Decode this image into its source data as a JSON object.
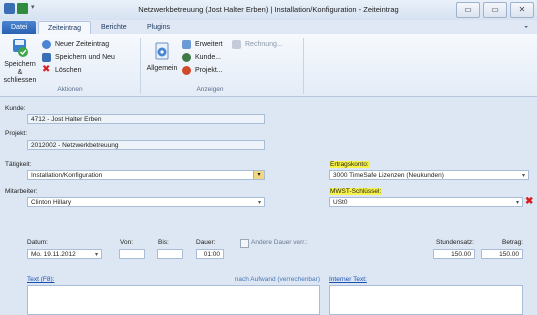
{
  "window": {
    "title": "Netzwerkbetreuung (Jost Halter Erben) | Installation/Konfiguration - Zeiteintrag",
    "controls": {
      "minimize": "▭",
      "maximize": "▭",
      "close": "✕"
    }
  },
  "tabs": [
    {
      "label": "Datei"
    },
    {
      "label": "Zeiteintrag"
    },
    {
      "label": "Berichte"
    },
    {
      "label": "Plugins"
    }
  ],
  "ribbon": {
    "aktionen": {
      "label": "Aktionen",
      "save_close": "Speichern & schliessen",
      "new_entry": "Neuer Zeiteintrag",
      "save_new": "Speichern und Neu",
      "delete": "Löschen"
    },
    "anzeigen": {
      "label": "Anzeigen",
      "allgemein": "Allgemein",
      "erweitert": "Erweitert",
      "rechnung": "Rechnung...",
      "kunde": "Kunde...",
      "projekt": "Projekt..."
    }
  },
  "form": {
    "kunde": {
      "label": "Kunde:",
      "value": "4712 - Jost Halter Erben"
    },
    "projekt": {
      "label": "Projekt:",
      "value": "2012002 - Netzwerkbetreuung"
    },
    "taetigkeit": {
      "label": "Tätigkeit:",
      "value": "Installation/Konfiguration"
    },
    "ertragskonto": {
      "label": "Ertragskonto:",
      "value": "3000 TimeSafe Lizenzen (Neukunden)"
    },
    "mitarbeiter": {
      "label": "Mitarbeiter:",
      "value": "Clinton Hillary"
    },
    "mwst": {
      "label": "MWST-Schlüssel:",
      "value": "USt0"
    },
    "datum": {
      "label": "Datum:",
      "value": "Mo. 19.11.2012"
    },
    "von": {
      "label": "Von:",
      "value": ""
    },
    "bis": {
      "label": "Bis:",
      "value": ""
    },
    "dauer": {
      "label": "Dauer:",
      "value": "01:00"
    },
    "andere_dauer": {
      "label": "Andere Dauer verr.:"
    },
    "stundensatz": {
      "label": "Stundensatz:",
      "value": "150.00"
    },
    "betrag": {
      "label": "Betrag:",
      "value": "150.00"
    },
    "text": {
      "label": "Text (F8):",
      "hint": "nach Aufwand (verrechenbar)"
    },
    "interner_text": {
      "label": "Interner Text:"
    }
  },
  "colors": {
    "file_tab": "#2a62b3",
    "highlight": "#f7f24a",
    "delete_red": "#d42020",
    "link": "#1a50b0"
  }
}
